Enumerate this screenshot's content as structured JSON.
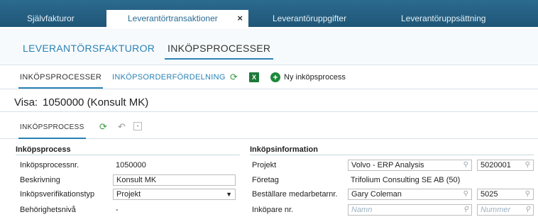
{
  "top_tabs": {
    "items": [
      "Självfakturor",
      "Leverantörtransaktioner",
      "Leverantöruppgifter",
      "Leverantöruppsättning"
    ],
    "close_glyph": "×"
  },
  "page_tabs": [
    "LEVERANTÖRSFAKTUROR",
    "INKÖPSPROCESSER"
  ],
  "sub_toolbar": {
    "tabs": [
      "INKÖPSPROCESSER",
      "INKÖPSORDERFÖRDELNING"
    ],
    "new_label": "Ny inköpsprocess"
  },
  "visa": {
    "label": "Visa:",
    "value": "1050000 (Konsult MK)"
  },
  "process_toolbar": {
    "tab": "INKÖPSPROCESS"
  },
  "left_section": {
    "title": "Inköpsprocess",
    "rows": [
      {
        "label": "Inköpsprocessnr.",
        "value": "1050000"
      },
      {
        "label": "Beskrivning",
        "value": "Konsult MK"
      },
      {
        "label": "Inköpsverifikationstyp",
        "value": "Projekt"
      },
      {
        "label": "Behörighetsnivå",
        "value": "-"
      }
    ]
  },
  "right_section": {
    "title": "Inköpsinformation",
    "rows": [
      {
        "label": "Projekt",
        "value": "Volvo - ERP Analysis",
        "value2": "5020001"
      },
      {
        "label": "Företag",
        "value": "Trifolium Consulting SE AB (50)"
      },
      {
        "label": "Beställare medarbetarnr.",
        "value": "Gary Coleman",
        "value2": "5025"
      },
      {
        "label": "Inköpare nr.",
        "placeholder": "Namn",
        "placeholder2": "Nummer"
      }
    ]
  },
  "colors": {
    "accent": "#2a82b5",
    "topbar": "#1f5677",
    "excel": "#1d7a3a"
  },
  "icons": [
    "refresh-icon",
    "excel-icon",
    "add-circle-icon",
    "undo-icon",
    "save-icon",
    "search-icon",
    "dropdown-arrow-icon"
  ]
}
